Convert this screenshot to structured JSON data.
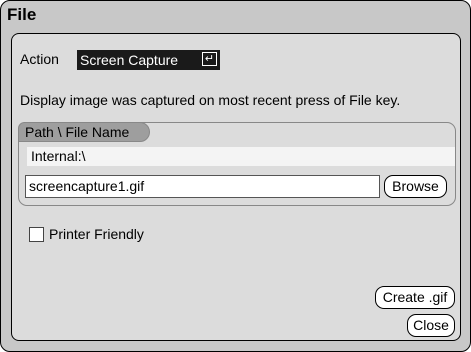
{
  "window": {
    "title": "File"
  },
  "action": {
    "label": "Action",
    "selected": "Screen Capture",
    "enter_glyph": "↵"
  },
  "info_text": "Display image was captured on most recent press of File key.",
  "path_group": {
    "title": "Path \\ File Name",
    "path": "Internal:\\",
    "filename": "screencapture1.gif",
    "browse_label": "Browse"
  },
  "printer_friendly": {
    "label": "Printer Friendly",
    "checked": false
  },
  "buttons": {
    "create_label": "Create .gif",
    "close_label": "Close"
  }
}
